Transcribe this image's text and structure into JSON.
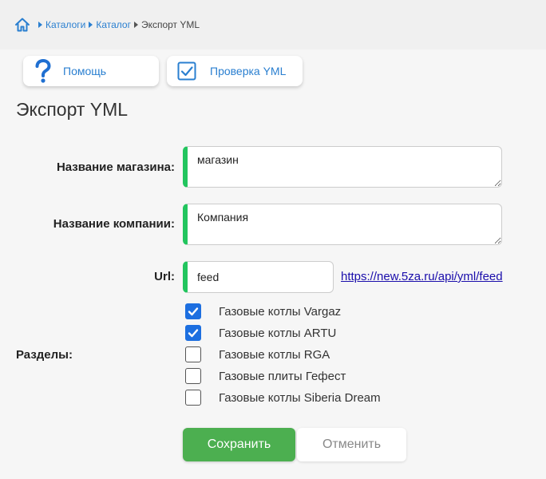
{
  "breadcrumb": {
    "items": [
      {
        "label": "Каталоги"
      },
      {
        "label": "Каталог"
      }
    ],
    "current": "Экспорт YML"
  },
  "toolbar": {
    "help_label": "Помощь",
    "check_label": "Проверка YML"
  },
  "page": {
    "title": "Экспорт YML"
  },
  "form": {
    "shop_label": "Название магазина:",
    "shop_value": "магазин",
    "company_label": "Название компании:",
    "company_value": "Компания",
    "url_label": "Url:",
    "url_value": "feed",
    "url_link": "https://new.5za.ru/api/yml/feed",
    "sections_label": "Разделы:",
    "sections": [
      {
        "label": "Газовые котлы Vargaz",
        "checked": true
      },
      {
        "label": "Газовые котлы ARTU",
        "checked": true
      },
      {
        "label": "Газовые котлы RGA",
        "checked": false
      },
      {
        "label": "Газовые плиты Гефест",
        "checked": false
      },
      {
        "label": "Газовые котлы Siberia Dream",
        "checked": false
      }
    ],
    "save_label": "Сохранить",
    "cancel_label": "Отменить"
  },
  "colors": {
    "accent": "#2a7fd0",
    "field_marker": "#22c55e",
    "save_bg": "#4caf50",
    "checkbox_on": "#1d6fe0"
  },
  "icons": {
    "home": "home-icon",
    "help": "question-mark-icon",
    "check": "checkbox-check-icon"
  }
}
